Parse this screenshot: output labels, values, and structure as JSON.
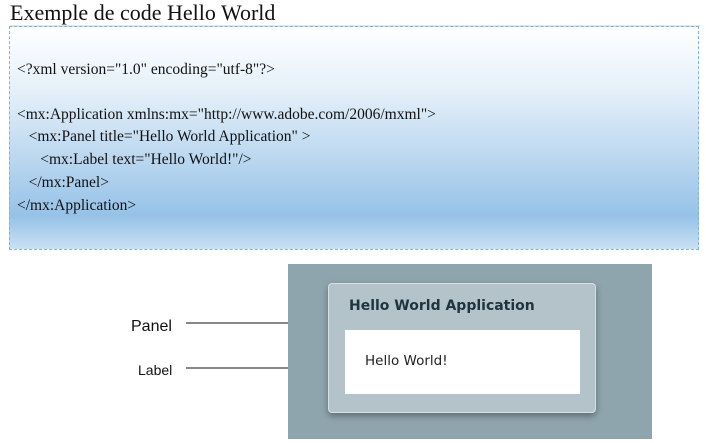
{
  "page": {
    "title": "Exemple de code Hello World"
  },
  "code": {
    "lines": [
      "<?xml version=\"1.0\" encoding=\"utf-8\"?>",
      "<mx:Application xmlns:mx=\"http://www.adobe.com/2006/mxml\">",
      "   <mx:Panel title=\"Hello World Application\" >",
      "      <mx:Label text=\"Hello World!\"/>",
      "   </mx:Panel>",
      "</mx:Application>"
    ]
  },
  "annotations": {
    "panel_label": "Panel",
    "label_label": "Label"
  },
  "preview": {
    "panel_title": "Hello World Application",
    "label_text": "Hello World!"
  },
  "colors": {
    "preview_background": "#8fa5ad",
    "panel_background": "#b4c3c9",
    "panel_title_text": "#1f3440",
    "code_gradient_end": "#96c2e8"
  }
}
